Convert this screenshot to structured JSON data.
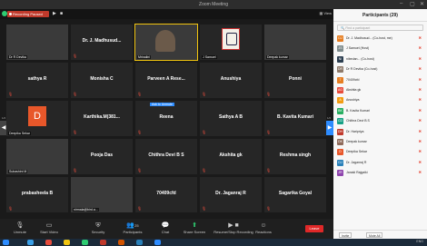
{
  "window": {
    "title": "Zoom Meeting"
  },
  "topbar": {
    "recording_label": "Recording Paused",
    "view_label": "View"
  },
  "grid": {
    "page_left": "1/2",
    "page_right": "1/2",
    "ask_unmute": "Ask to Unmute"
  },
  "tiles": [
    {
      "name": "",
      "label": "Dr R Devika",
      "video": true
    },
    {
      "name": "Dr. J. Madhusud...",
      "label": ""
    },
    {
      "name": "",
      "label": "Mrinalini",
      "video": true,
      "active": true
    },
    {
      "name": "",
      "label": "J Samuel",
      "crest": true
    },
    {
      "name": "",
      "label": "Deepak kumar",
      "video": true
    },
    {
      "name": "sathya R",
      "label": ""
    },
    {
      "name": "Monisha C",
      "label": ""
    },
    {
      "name": "Parveen A Rese...",
      "label": ""
    },
    {
      "name": "Anushiya",
      "label": ""
    },
    {
      "name": "Ponni",
      "label": ""
    },
    {
      "name": "",
      "label": "Deepika Sekar",
      "avatar": "D"
    },
    {
      "name": "Karthika.M(381...",
      "label": ""
    },
    {
      "name": "Reena",
      "label": ""
    },
    {
      "name": "Sathya A B",
      "label": ""
    },
    {
      "name": "B. Kavita Kumari",
      "label": ""
    },
    {
      "name": "",
      "label": "Subashini M",
      "video": true
    },
    {
      "name": "Pooja Das",
      "label": ""
    },
    {
      "name": "Chithra Devi B S",
      "label": ""
    },
    {
      "name": "Akshita gk",
      "label": ""
    },
    {
      "name": "Reshma singh",
      "label": ""
    },
    {
      "name": "prabasheela B",
      "label": ""
    },
    {
      "name": "",
      "label": "nirmala@bird.a...",
      "video": true
    },
    {
      "name": "70409cfd",
      "label": ""
    },
    {
      "name": "Dr. Jaganraj R",
      "label": ""
    },
    {
      "name": "Sagarika Goyal",
      "label": ""
    }
  ],
  "toolbar": {
    "unmute": "Unmute",
    "start_video": "Start Video",
    "security": "Security",
    "participants": "Participants",
    "participants_count": "25",
    "chat": "Chat",
    "share": "Share Screen",
    "record": "Resume/Stop Recording",
    "reactions": "Reactions",
    "leave": "Leave"
  },
  "panel": {
    "title": "Participants (29)",
    "search_placeholder": "Find a participant",
    "invite": "Invite",
    "mute_all": "Mute All",
    "people": [
      {
        "name": "Dr. J. Madhusud... (Co-host, me)",
        "initials": "DJ",
        "color": "#e67e22"
      },
      {
        "name": "J Samuel (Host)",
        "initials": "JS",
        "color": "#7f8c8d"
      },
      {
        "name": "nibedan... (Co-host)",
        "initials": "NI",
        "color": "#2c3e50"
      },
      {
        "name": "Dr R Devika (Co-host)",
        "initials": "DR",
        "color": "#8e7a6a"
      },
      {
        "name": "70409cfd",
        "initials": "7",
        "color": "#e67e22"
      },
      {
        "name": "Akshita gk",
        "initials": "AG",
        "color": "#e74c3c"
      },
      {
        "name": "Anushiya",
        "initials": "A",
        "color": "#f39c12"
      },
      {
        "name": "B. Kavita Kumari",
        "initials": "BK",
        "color": "#27ae60"
      },
      {
        "name": "Chithra Devi B S",
        "initials": "CD",
        "color": "#16a085"
      },
      {
        "name": "Dr. Haripriya",
        "initials": "DH",
        "color": "#c0392b"
      },
      {
        "name": "Deepak kumar",
        "initials": "DK",
        "color": "#8e6a5a"
      },
      {
        "name": "Deepika Sekar",
        "initials": "D",
        "color": "#e8572a"
      },
      {
        "name": "Dr. Jaganraj R",
        "initials": "DJ",
        "color": "#2980b9"
      },
      {
        "name": "Janaki Rajgaiki",
        "initials": "JR",
        "color": "#8e44ad"
      }
    ]
  },
  "taskbar": {
    "time": "ENG"
  }
}
